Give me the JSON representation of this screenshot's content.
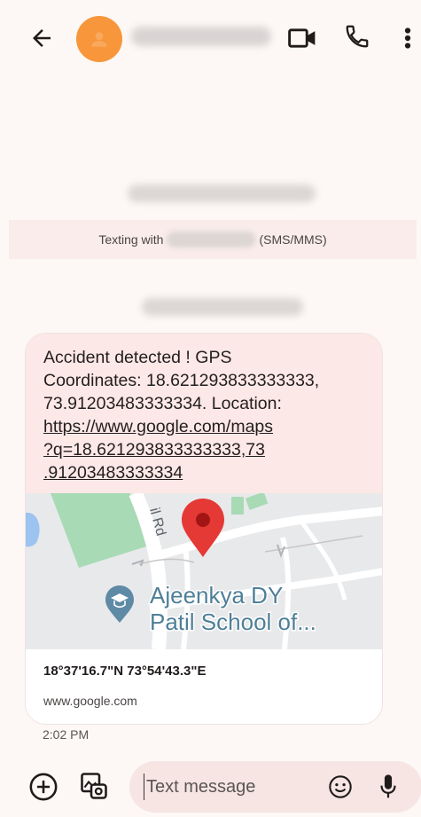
{
  "header": {
    "back_icon": "arrow-left-icon",
    "video_icon": "video-call-icon",
    "call_icon": "phone-icon",
    "more_icon": "more-vert-icon",
    "accent": "#f7963a"
  },
  "banner": {
    "prefix": "Texting with",
    "suffix": "(SMS/MMS)"
  },
  "message": {
    "line1": "Accident detected ! GPS",
    "line2": "Coordinates: 18.621293833333333,",
    "line3": "73.91203483333334. Location:",
    "link1": "https://www.google.com/maps",
    "link2": "?q=18.621293833333333,73",
    "link3": ".91203483333334",
    "map_label_line1": "Ajeenkya DY",
    "map_label_line2": "Patil School of...",
    "map_road_label": "il Rd",
    "preview_title": "18°37'16.7\"N 73°54'43.3\"E",
    "preview_domain": "www.google.com",
    "time": "2:02 PM"
  },
  "composer": {
    "placeholder": "Text message",
    "add_icon": "add-circle-icon",
    "gallery_icon": "gallery-icon",
    "emoji_icon": "emoji-icon",
    "mic_icon": "mic-icon"
  }
}
